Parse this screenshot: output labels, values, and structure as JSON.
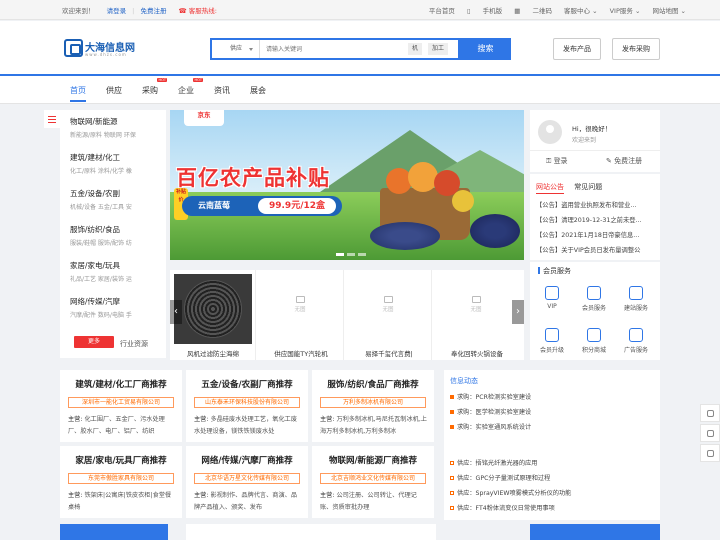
{
  "topbar": {
    "welcome": "欢迎来到！",
    "login": "请登录",
    "register": "免费注册",
    "hotline": "客服热线:",
    "links": [
      "平台首页",
      "手机版",
      "二维码",
      "客服中心 ⌄",
      "VIP服务 ⌄",
      "网站地图 ⌄"
    ]
  },
  "logo": {
    "title": "大海信息网",
    "sub": "www.dhzs.com"
  },
  "search": {
    "category": "供应",
    "placeholder": "请输入关键词",
    "tags": [
      "机",
      "加工"
    ],
    "button": "搜索"
  },
  "header_buttons": [
    "发布产品",
    "发布采购"
  ],
  "nav": {
    "items": [
      "首页",
      "供应",
      "采购",
      "企业",
      "资讯",
      "展会"
    ],
    "hot": "HOT"
  },
  "categories": [
    {
      "title": "物联网/新能源",
      "desc": "新能源/原料  物联网  环保"
    },
    {
      "title": "建筑/建材/化工",
      "desc": "化工/原料  涂料/化学  橡"
    },
    {
      "title": "五金/设备/农副",
      "desc": "机械/设备  五金/工具  安"
    },
    {
      "title": "服饰/纺织/食品",
      "desc": "服装/鞋帽  服饰/配饰  纺"
    },
    {
      "title": "家居/家电/玩具",
      "desc": "礼品/工艺  家居/装饰  运"
    },
    {
      "title": "网络/传媒/汽摩",
      "desc": "汽摩/配件  数码/电脑  手"
    }
  ],
  "cat_more": "更多",
  "cat_res": "行业资源",
  "banner": {
    "brand": "京东",
    "headline": "百亿农产品补贴",
    "seal": "补贴价",
    "product": "云南蓝莓",
    "price": "99.9元/12盒"
  },
  "products": [
    {
      "name": "风机过滤防尘海绵",
      "img": ""
    },
    {
      "name": "供应国能TY汽轮机",
      "img": "无图"
    },
    {
      "name": "易择千玺代言费|",
      "img": "无图"
    },
    {
      "name": "奉化回转火锅设备",
      "img": "无图"
    }
  ],
  "user": {
    "greeting": "Hi，很晚好！",
    "welcome": "欢迎来到",
    "login": "登录",
    "register": "免费注册"
  },
  "announce": {
    "tabs": [
      "网站公告",
      "常见问题"
    ],
    "items": [
      "【公告】盗用营业执照发布和营业...",
      "【公告】清理2019-12-31之前未登...",
      "【公告】2021年1月18日帝豪信息...",
      "【公告】关于VIP会员日发布量调整公"
    ]
  },
  "member": {
    "title": "会员服务",
    "items": [
      "VIP",
      "会员服务",
      "建站服务",
      "会员升级",
      "积分商城",
      "广告服务"
    ]
  },
  "recs": [
    {
      "title": "建筑/建材/化工厂商推荐",
      "company": "深圳市一能化工贸易有限公司",
      "main_label": "主营:",
      "main": "化工围厂、五金厂、污水处理厂、胶水厂、电厂、铝厂、纺织"
    },
    {
      "title": "五金/设备/农副厂商推荐",
      "company": "山东泰禾环保科技股份有限公司",
      "main_label": "主营:",
      "main": "多晶硅废水处理工艺，氧化工废水处理设备，镁铁铁镁废水处"
    },
    {
      "title": "服饰/纺织/食品厂商推荐",
      "company": "万利多制冰机有限公司",
      "main_label": "主营:",
      "main": "万利多制冰机,马尼托瓦制冰机,上海万利多制冰机,万利多制冰"
    },
    {
      "title": "家居/家电/玩具厂商推荐",
      "company": "东莞市傲胜家具有限公司",
      "main_label": "主营:",
      "main": "铁架床|公寓床|铁皮衣柜|食堂餐桌椅"
    },
    {
      "title": "网络/传媒/汽摩厂商推荐",
      "company": "北京华语万星文化传媒有限公司",
      "main_label": "主营:",
      "main": "影视制作、品牌代言、商演、品牌产品植入、颁奖、发布"
    },
    {
      "title": "物联网/新能源厂商推荐",
      "company": "北京吉顺鸿业文化传媒有限公司",
      "main_label": "主营:",
      "main": "公司注册、公司转让、代理记账、资质审批办理"
    }
  ],
  "info": {
    "title": "信息动态",
    "items": [
      "求购：PCR检测实验室建设",
      "求购：医学检测实验室建设",
      "求购：实验室通风系统设计",
      "供应：捂铭光纤激光器的应用",
      "供应：GPC分子量测试原理和过程",
      "供应：SprayVIEW喷雾模式分析仪的功能",
      "供应：FT4粉体流变仪日常使用事项"
    ]
  },
  "colors": {
    "primary": "#2f76e6",
    "accent": "#e33",
    "orange": "#ff6a00"
  }
}
